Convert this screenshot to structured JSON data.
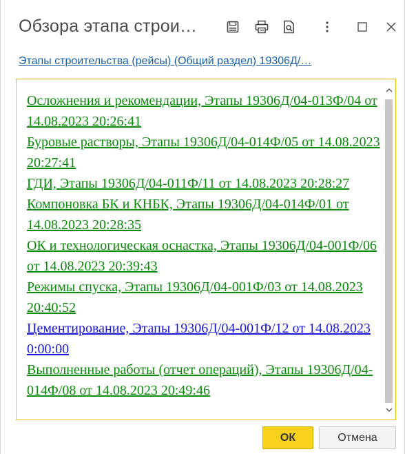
{
  "window": {
    "title": "Обзора этапа строи…"
  },
  "toolbar": {
    "icons": [
      "save-icon",
      "print-icon",
      "preview-icon",
      "more-icon",
      "maximize-icon",
      "close-icon"
    ]
  },
  "link": {
    "text": "Этапы строительства (рейсы) (Общий раздел) 19306Д/…"
  },
  "list": {
    "items": [
      {
        "text": "Осложнения и рекомендации, Этапы 19306Д/04-013Ф/04 от 14.08.2023 20:26:41",
        "color": "#0b8a0b"
      },
      {
        "text": "Буровые растворы, Этапы 19306Д/04-014Ф/05 от 14.08.2023 20:27:41",
        "color": "#0b8a0b"
      },
      {
        "text": "ГДИ, Этапы 19306Д/04-011Ф/11 от 14.08.2023 20:28:27",
        "color": "#0b8a0b"
      },
      {
        "text": "Компоновка БК и КНБК, Этапы 19306Д/04-014Ф/01 от 14.08.2023 20:28:35",
        "color": "#0b8a0b"
      },
      {
        "text": "ОК и технологическая оснастка, Этапы 19306Д/04-001Ф/06 от 14.08.2023 20:39:43",
        "color": "#0b8a0b"
      },
      {
        "text": "Режимы спуска, Этапы 19306Д/04-001Ф/03 от 14.08.2023 20:40:52",
        "color": "#0b8a0b"
      },
      {
        "text": "Цементирование, Этапы 19306Д/04-001Ф/12 от 14.08.2023 0:00:00",
        "color": "#1a1ad6"
      },
      {
        "text": "Выполненные работы (отчет операций), Этапы 19306Д/04-014Ф/08 от 14.08.2023 20:49:46",
        "color": "#0b8a0b"
      }
    ]
  },
  "buttons": {
    "ok_label": "ОК",
    "cancel_label": "Отмена"
  },
  "colors": {
    "accent": "#f7d11a",
    "frame_border": "#f0c000",
    "link": "#1a5fa8"
  }
}
